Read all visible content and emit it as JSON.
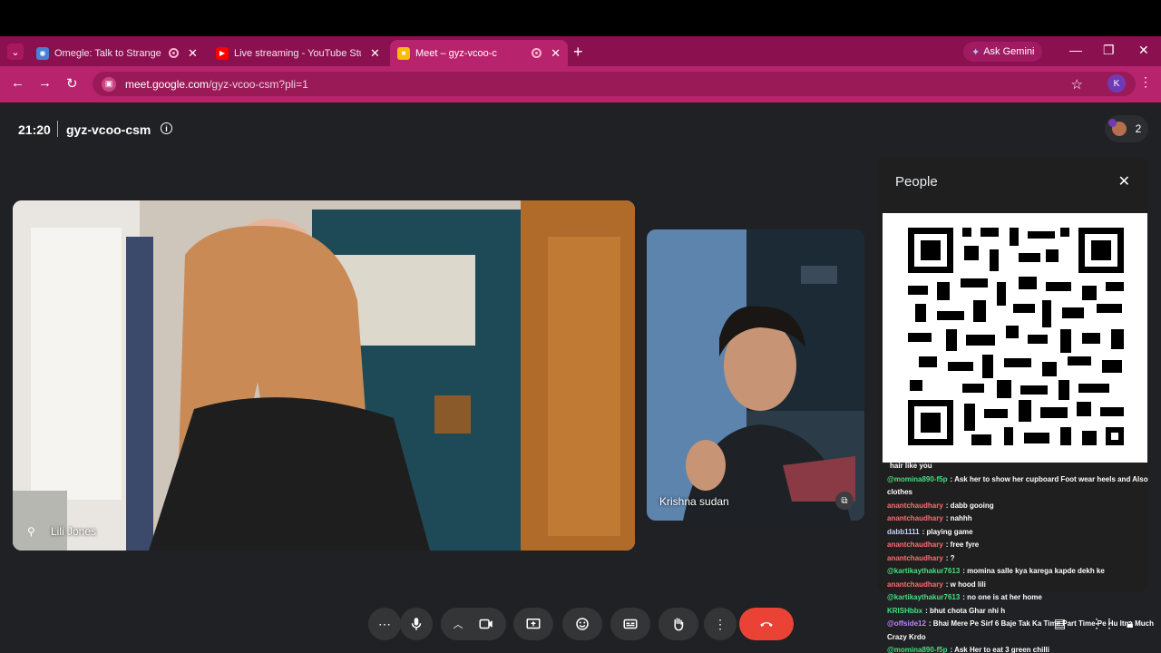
{
  "browser": {
    "tabs": [
      {
        "title": "Omegle: Talk to Strangers!",
        "favicon": "omegle-icon",
        "recording": true,
        "active": false
      },
      {
        "title": "Live streaming - YouTube Studio",
        "favicon": "youtube-icon",
        "recording": false,
        "active": false
      },
      {
        "title": "Meet – gyz-vcoo-csm",
        "favicon": "meet-icon",
        "recording": true,
        "active": true
      }
    ],
    "gemini_label": "Ask Gemini",
    "url_host": "meet.google.com",
    "url_path": "/gyz-vcoo-csm?pli=1",
    "profile_initial": "K",
    "accent": "#b8236d"
  },
  "meet": {
    "time": "21:20",
    "code": "gyz-vcoo-csm",
    "participant_count": "2",
    "participants": [
      {
        "name": "Lili Jones"
      },
      {
        "name": "Krishna sudan"
      }
    ],
    "people_panel_title": "People"
  },
  "chat": [
    {
      "user": "",
      "text": "hair like you",
      "color": "#ffffff"
    },
    {
      "user": "@momina890-f5p",
      "text": ": Ask her to show her cupboard Foot wear heels and Also clothes",
      "color": "#4ade80"
    },
    {
      "user": "anantchaudhary",
      "text": ": dabb gooing",
      "color": "#f87171"
    },
    {
      "user": "anantchaudhary",
      "text": ": nahhh",
      "color": "#f87171"
    },
    {
      "user": "dabb1111",
      "text": ": playing game",
      "color": "#c7d2fe"
    },
    {
      "user": "anantchaudhary",
      "text": ": free fyre",
      "color": "#f87171"
    },
    {
      "user": "anantchaudhary",
      "text": ": ?",
      "color": "#f87171"
    },
    {
      "user": "@kartikaythakur7613",
      "text": ": momina salle kya karega kapde dekh ke",
      "color": "#4ade80"
    },
    {
      "user": "anantchaudhary",
      "text": ": w hood lili",
      "color": "#f87171"
    },
    {
      "user": "@kartikaythakur7613",
      "text": ": no one is at her home",
      "color": "#4ade80"
    },
    {
      "user": "KRISHbbx",
      "text": ": bhut chota Ghar nhi h",
      "color": "#4ade80"
    },
    {
      "user": "@offside12",
      "text": ": Bhai Mere Pe Sirf 6 Baje Tak Ka Time Part Time Pe Hu Itna Much Crazy Krdo",
      "color": "#c084fc"
    },
    {
      "user": "@momina890-f5p",
      "text": ": Ask Her to eat 3 green chilli",
      "color": "#4ade80"
    }
  ]
}
